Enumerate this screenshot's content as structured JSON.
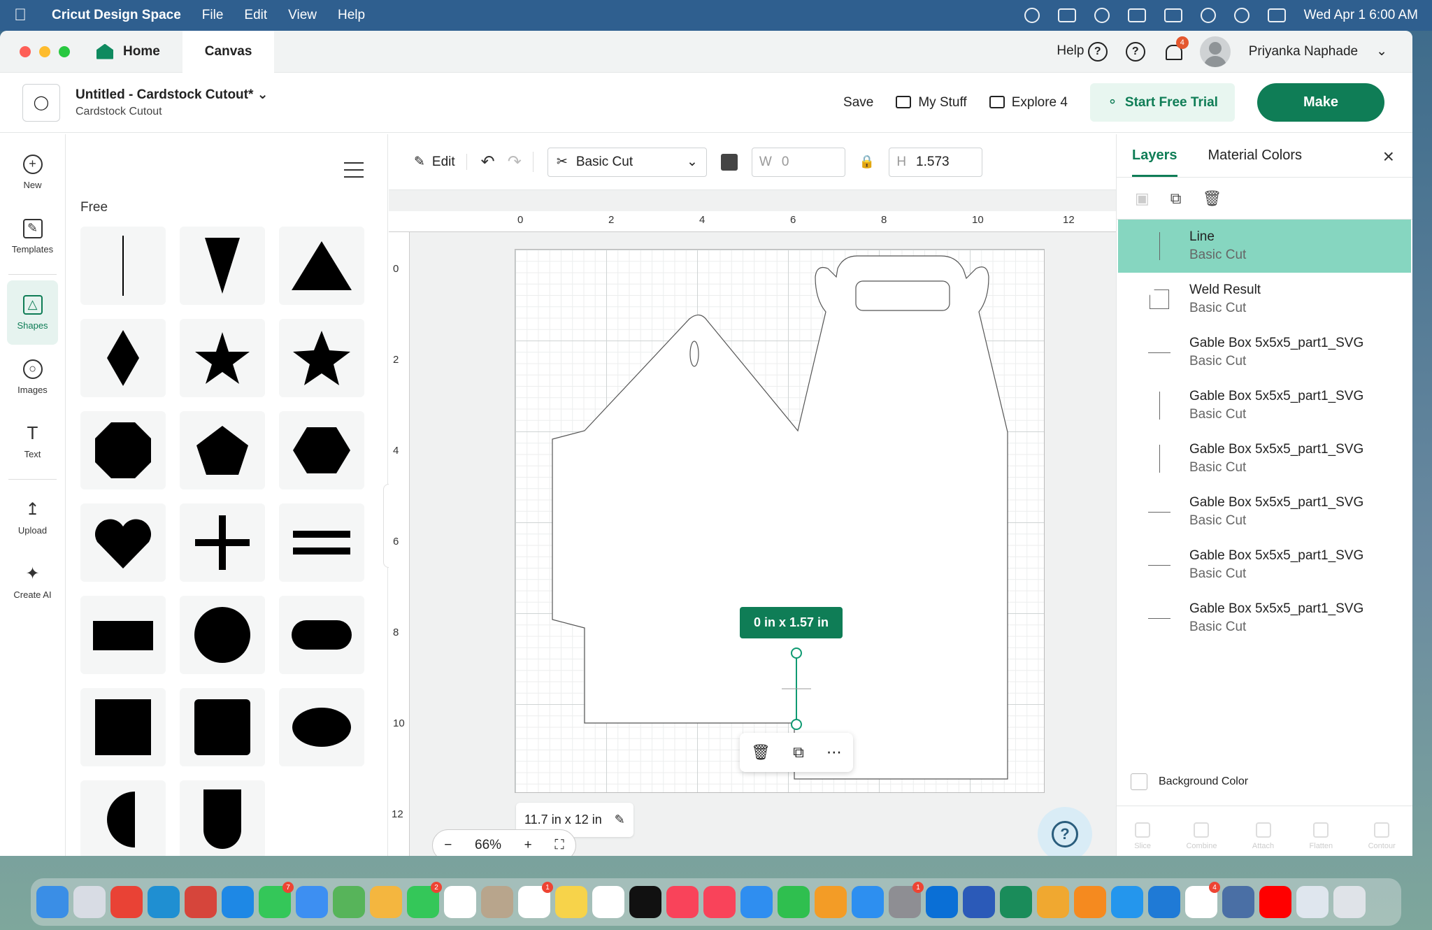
{
  "menubar": {
    "app_name": "Cricut Design Space",
    "items": [
      "File",
      "Edit",
      "View",
      "Help"
    ],
    "datetime": "Wed Apr 1  6:00 AM"
  },
  "titlebar": {
    "home_tab": "Home",
    "canvas_tab": "Canvas",
    "help": "Help",
    "notification_count": "4",
    "user_name": "Priyanka Naphade"
  },
  "project": {
    "title": "Untitled - Cardstock Cutout*",
    "subtitle": "Cardstock Cutout",
    "save": "Save",
    "my_stuff": "My Stuff",
    "explore": "Explore 4",
    "trial": "Start Free Trial",
    "make": "Make"
  },
  "leftnav": {
    "new": "New",
    "templates": "Templates",
    "shapes": "Shapes",
    "images": "Images",
    "text": "Text",
    "upload": "Upload",
    "create_ai": "Create AI"
  },
  "shapes_panel": {
    "section": "Free",
    "shapes": [
      "line",
      "triangle-down",
      "triangle",
      "diamond",
      "star-5",
      "star-5-bold",
      "octagon",
      "pentagon",
      "hexagon",
      "heart",
      "plus",
      "equals",
      "rectangle",
      "circle",
      "rounded-rectangle",
      "square",
      "rounded-square",
      "oval",
      "half-circle",
      "arch"
    ]
  },
  "toolbar": {
    "edit": "Edit",
    "operation": "Basic Cut",
    "w_label": "W",
    "w_value": "0",
    "h_label": "H",
    "h_value": "1.573",
    "color": "#444444"
  },
  "canvas": {
    "ruler_top": [
      "0",
      "2",
      "4",
      "6",
      "8",
      "10",
      "12"
    ],
    "ruler_left": [
      "0",
      "2",
      "4",
      "6",
      "8",
      "10",
      "12"
    ],
    "dimension_badge": "0  in x 1.57  in",
    "mat_size": "11.7 in x 12 in",
    "zoom": "66%"
  },
  "layers_panel": {
    "tab_layers": "Layers",
    "tab_material": "Material Colors",
    "layers": [
      {
        "name": "Line",
        "op": "Basic Cut",
        "thumb": "vl",
        "selected": true
      },
      {
        "name": "Weld Result",
        "op": "Basic Cut",
        "thumb": "wr",
        "selected": false
      },
      {
        "name": "Gable Box 5x5x5_part1_SVG",
        "op": "Basic Cut",
        "thumb": "hl",
        "selected": false
      },
      {
        "name": "Gable Box 5x5x5_part1_SVG",
        "op": "Basic Cut",
        "thumb": "vl",
        "selected": false
      },
      {
        "name": "Gable Box 5x5x5_part1_SVG",
        "op": "Basic Cut",
        "thumb": "vl",
        "selected": false
      },
      {
        "name": "Gable Box 5x5x5_part1_SVG",
        "op": "Basic Cut",
        "thumb": "hl",
        "selected": false
      },
      {
        "name": "Gable Box 5x5x5_part1_SVG",
        "op": "Basic Cut",
        "thumb": "hl",
        "selected": false
      },
      {
        "name": "Gable Box 5x5x5_part1_SVG",
        "op": "Basic Cut",
        "thumb": "hl",
        "selected": false
      }
    ],
    "background_color": "Background Color",
    "bottom_tools": [
      "Slice",
      "Combine",
      "Attach",
      "Flatten",
      "Contour"
    ]
  },
  "dock": {
    "apps": [
      {
        "name": "finder-icon",
        "color": "#3a8ee6"
      },
      {
        "name": "launchpad-icon",
        "color": "#d8dce4"
      },
      {
        "name": "chrome-icon",
        "color": "#e94235"
      },
      {
        "name": "edge-icon",
        "color": "#1f8fd2"
      },
      {
        "name": "snip-icon",
        "color": "#d6453b"
      },
      {
        "name": "safari-icon",
        "color": "#1e88e5"
      },
      {
        "name": "messages-icon",
        "color": "#34c759",
        "badge": "7"
      },
      {
        "name": "mail-icon",
        "color": "#3d8ff2"
      },
      {
        "name": "maps-icon",
        "color": "#57b45a"
      },
      {
        "name": "photos-icon",
        "color": "#f4b63f"
      },
      {
        "name": "facetime-icon",
        "color": "#34c759",
        "badge": "2"
      },
      {
        "name": "calendar-icon",
        "color": "#ffffff"
      },
      {
        "name": "contacts-icon",
        "color": "#b8a58c"
      },
      {
        "name": "reminders-icon",
        "color": "#ffffff",
        "badge": "1"
      },
      {
        "name": "notes-icon",
        "color": "#f7d34a"
      },
      {
        "name": "freeform-icon",
        "color": "#ffffff"
      },
      {
        "name": "tv-icon",
        "color": "#111111"
      },
      {
        "name": "music-icon",
        "color": "#f9435a"
      },
      {
        "name": "news-icon",
        "color": "#f9435a"
      },
      {
        "name": "keynote-icon",
        "color": "#2f8ef0"
      },
      {
        "name": "numbers-icon",
        "color": "#2fbf4f"
      },
      {
        "name": "pages-icon",
        "color": "#f39c26"
      },
      {
        "name": "appstore-icon",
        "color": "#2d8ff0"
      },
      {
        "name": "settings-icon",
        "color": "#8e8e93",
        "badge": "1"
      },
      {
        "name": "windows-icon",
        "color": "#0a6fd6"
      },
      {
        "name": "word-icon",
        "color": "#2b5ab8"
      },
      {
        "name": "leaf-icon",
        "color": "#1a8c5a"
      },
      {
        "name": "amphetamine-icon",
        "color": "#f0a830"
      },
      {
        "name": "books-icon",
        "color": "#f58a1f"
      },
      {
        "name": "docker-icon",
        "color": "#2496ed"
      },
      {
        "name": "vscode-icon",
        "color": "#1f7ad6"
      },
      {
        "name": "cricut-icon",
        "color": "#ffffff",
        "badge": "4"
      },
      {
        "name": "storage-icon",
        "color": "#4a6fa5"
      },
      {
        "name": "youtube-icon",
        "color": "#ff0000"
      },
      {
        "name": "screen-icon",
        "color": "#dfe6ee"
      },
      {
        "name": "trash-icon",
        "color": "#dfe3e8"
      }
    ]
  }
}
